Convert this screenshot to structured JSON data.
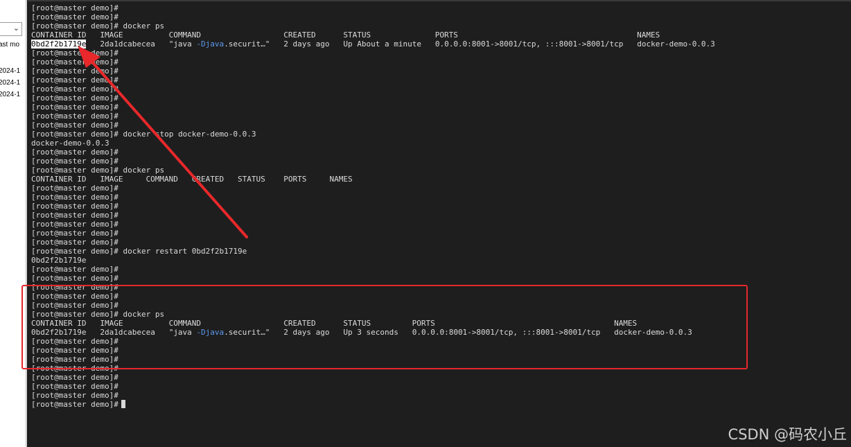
{
  "left_panel": {
    "label": "ast mo",
    "dates": [
      "2024-1",
      "2024-1",
      "2024-1"
    ]
  },
  "terminal": {
    "prompt": "[root@master demo]#",
    "lines": [
      {
        "type": "prompt",
        "cmd": ""
      },
      {
        "type": "prompt",
        "cmd": ""
      },
      {
        "type": "prompt",
        "cmd": "docker ps"
      },
      {
        "type": "text",
        "text": "CONTAINER ID   IMAGE          COMMAND                  CREATED      STATUS              PORTS                                       NAMES"
      },
      {
        "type": "row",
        "id": "0bd2f2b1719e",
        "highlight": true,
        "before": "   2da1dcabecea   \"java ",
        "opt": "-Djava",
        "after": ".securit…\"   2 days ago   Up About a minute   0.0.0.0:8001->8001/tcp, :::8001->8001/tcp   docker-demo-0.0.3"
      },
      {
        "type": "prompt",
        "cmd": ""
      },
      {
        "type": "prompt",
        "cmd": ""
      },
      {
        "type": "prompt",
        "cmd": ""
      },
      {
        "type": "prompt",
        "cmd": ""
      },
      {
        "type": "prompt",
        "cmd": ""
      },
      {
        "type": "prompt",
        "cmd": ""
      },
      {
        "type": "prompt",
        "cmd": ""
      },
      {
        "type": "prompt",
        "cmd": ""
      },
      {
        "type": "prompt",
        "cmd": ""
      },
      {
        "type": "prompt",
        "cmd": "docker stop docker-demo-0.0.3"
      },
      {
        "type": "text",
        "text": "docker-demo-0.0.3"
      },
      {
        "type": "prompt",
        "cmd": ""
      },
      {
        "type": "prompt",
        "cmd": ""
      },
      {
        "type": "prompt",
        "cmd": "docker ps"
      },
      {
        "type": "text",
        "text": "CONTAINER ID   IMAGE     COMMAND   CREATED   STATUS    PORTS     NAMES"
      },
      {
        "type": "prompt",
        "cmd": ""
      },
      {
        "type": "prompt",
        "cmd": ""
      },
      {
        "type": "prompt",
        "cmd": ""
      },
      {
        "type": "prompt",
        "cmd": ""
      },
      {
        "type": "prompt",
        "cmd": ""
      },
      {
        "type": "prompt",
        "cmd": ""
      },
      {
        "type": "prompt",
        "cmd": ""
      },
      {
        "type": "prompt",
        "cmd": "docker restart 0bd2f2b1719e"
      },
      {
        "type": "text",
        "text": "0bd2f2b1719e"
      },
      {
        "type": "prompt",
        "cmd": ""
      },
      {
        "type": "prompt",
        "cmd": ""
      },
      {
        "type": "prompt",
        "cmd": ""
      },
      {
        "type": "prompt",
        "cmd": ""
      },
      {
        "type": "prompt",
        "cmd": ""
      },
      {
        "type": "prompt",
        "cmd": "docker ps"
      },
      {
        "type": "text",
        "text": "CONTAINER ID   IMAGE          COMMAND                  CREATED      STATUS         PORTS                                       NAMES"
      },
      {
        "type": "row",
        "id": "0bd2f2b1719e",
        "highlight": false,
        "before": "   2da1dcabecea   \"java ",
        "opt": "-Djava",
        "after": ".securit…\"   2 days ago   Up 3 seconds   0.0.0.0:8001->8001/tcp, :::8001->8001/tcp   docker-demo-0.0.3"
      },
      {
        "type": "prompt",
        "cmd": ""
      },
      {
        "type": "prompt",
        "cmd": ""
      },
      {
        "type": "prompt",
        "cmd": ""
      },
      {
        "type": "prompt",
        "cmd": ""
      },
      {
        "type": "prompt",
        "cmd": ""
      },
      {
        "type": "prompt",
        "cmd": ""
      },
      {
        "type": "prompt",
        "cmd": ""
      },
      {
        "type": "prompt",
        "cmd": "",
        "cursor": true
      }
    ]
  },
  "colors": {
    "background": "#1e1e1e",
    "text": "#dcdcdc",
    "option_highlight": "#5b9bf0",
    "annotation_red": "#e8282b"
  },
  "watermark": "CSDN @码农小丘"
}
